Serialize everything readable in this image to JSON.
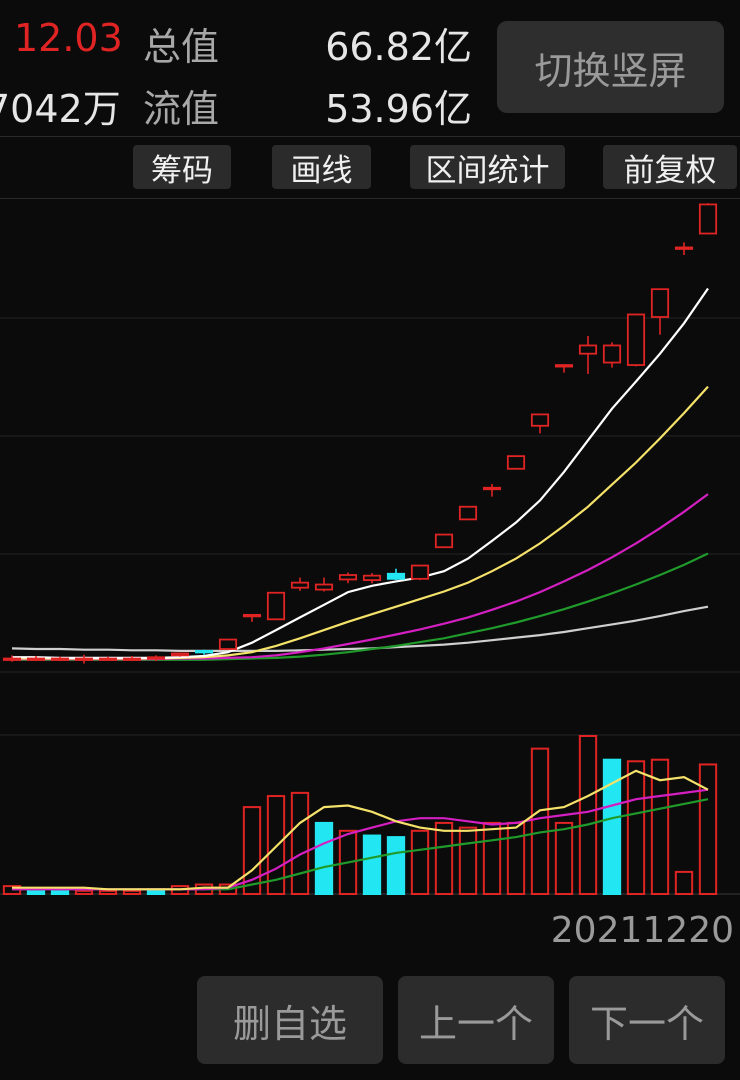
{
  "header": {
    "price": "12.03",
    "volume": "7042万",
    "total_value_label": "总值",
    "total_value": "66.82亿",
    "float_value_label": "流值",
    "float_value": "53.96亿",
    "switch_button": "切换竖屏"
  },
  "toolbar": {
    "chips": "筹码",
    "draw_line": "画线",
    "range_stats": "区间统计",
    "adjust": "前复权"
  },
  "chart": {
    "date_label": "20211220"
  },
  "bottom": {
    "delete_watch": "删自选",
    "previous": "上一个",
    "next": "下一个"
  },
  "colors": {
    "up": "#e02424",
    "down": "#22e6f2",
    "ma5": "#ffffff",
    "ma10": "#f5e26a",
    "ma20": "#d41fc2",
    "ma30": "#1f9a2b",
    "ma60": "#cfcfcf"
  },
  "chart_data": {
    "type": "candlestick",
    "candles": [
      {
        "o": 1.0,
        "h": 1.05,
        "l": 0.95,
        "c": 1.0,
        "dir": "flat"
      },
      {
        "o": 1.0,
        "h": 1.04,
        "l": 0.96,
        "c": 1.0,
        "dir": "flat"
      },
      {
        "o": 1.0,
        "h": 1.03,
        "l": 0.96,
        "c": 1.0,
        "dir": "flat"
      },
      {
        "o": 1.0,
        "h": 1.06,
        "l": 0.92,
        "c": 1.0,
        "dir": "flat"
      },
      {
        "o": 1.0,
        "h": 1.03,
        "l": 0.96,
        "c": 1.0,
        "dir": "flat"
      },
      {
        "o": 1.0,
        "h": 1.04,
        "l": 0.96,
        "c": 1.0,
        "dir": "flat"
      },
      {
        "o": 1.0,
        "h": 1.05,
        "l": 0.96,
        "c": 1.02,
        "dir": "flat"
      },
      {
        "o": 1.05,
        "h": 1.08,
        "l": 1.03,
        "c": 1.08,
        "dir": "up"
      },
      {
        "o": 1.12,
        "h": 1.14,
        "l": 1.06,
        "c": 1.1,
        "dir": "down"
      },
      {
        "o": 1.15,
        "h": 1.3,
        "l": 1.15,
        "c": 1.3,
        "dir": "up"
      },
      {
        "o": 1.68,
        "h": 1.7,
        "l": 1.58,
        "c": 1.69,
        "dir": "up"
      },
      {
        "o": 1.62,
        "h": 2.04,
        "l": 1.62,
        "c": 2.04,
        "dir": "up"
      },
      {
        "o": 2.12,
        "h": 2.28,
        "l": 2.07,
        "c": 2.2,
        "dir": "up"
      },
      {
        "o": 2.09,
        "h": 2.28,
        "l": 2.06,
        "c": 2.17,
        "dir": "up"
      },
      {
        "o": 2.25,
        "h": 2.36,
        "l": 2.19,
        "c": 2.32,
        "dir": "up"
      },
      {
        "o": 2.24,
        "h": 2.35,
        "l": 2.19,
        "c": 2.31,
        "dir": "up"
      },
      {
        "o": 2.34,
        "h": 2.42,
        "l": 2.24,
        "c": 2.26,
        "dir": "down"
      },
      {
        "o": 2.26,
        "h": 2.47,
        "l": 2.24,
        "c": 2.47,
        "dir": "up"
      },
      {
        "o": 2.76,
        "h": 2.96,
        "l": 2.76,
        "c": 2.96,
        "dir": "up"
      },
      {
        "o": 3.2,
        "h": 3.4,
        "l": 3.2,
        "c": 3.4,
        "dir": "up"
      },
      {
        "o": 3.68,
        "h": 3.76,
        "l": 3.56,
        "c": 3.7,
        "dir": "up"
      },
      {
        "o": 4.0,
        "h": 4.2,
        "l": 4.0,
        "c": 4.2,
        "dir": "up"
      },
      {
        "o": 4.68,
        "h": 4.86,
        "l": 4.56,
        "c": 4.86,
        "dir": "up"
      },
      {
        "o": 5.63,
        "h": 5.65,
        "l": 5.52,
        "c": 5.64,
        "dir": "up"
      },
      {
        "o": 5.82,
        "h": 6.1,
        "l": 5.5,
        "c": 5.95,
        "dir": "up"
      },
      {
        "o": 5.68,
        "h": 6.0,
        "l": 5.6,
        "c": 5.95,
        "dir": "up"
      },
      {
        "o": 5.64,
        "h": 6.44,
        "l": 5.62,
        "c": 6.44,
        "dir": "up"
      },
      {
        "o": 6.4,
        "h": 6.84,
        "l": 6.12,
        "c": 6.84,
        "dir": "up"
      },
      {
        "o": 7.5,
        "h": 7.58,
        "l": 7.38,
        "c": 7.5,
        "dir": "up"
      },
      {
        "o": 7.72,
        "h": 8.2,
        "l": 7.72,
        "c": 8.18,
        "dir": "up"
      }
    ],
    "ma5": [
      1.02,
      1.02,
      1.01,
      1.01,
      1.01,
      1.01,
      1.01,
      1.02,
      1.04,
      1.1,
      1.25,
      1.45,
      1.65,
      1.85,
      2.05,
      2.15,
      2.22,
      2.28,
      2.38,
      2.58,
      2.86,
      3.15,
      3.5,
      3.95,
      4.45,
      4.95,
      5.38,
      5.82,
      6.3,
      6.85
    ],
    "ma10": [
      1.0,
      1.0,
      1.0,
      1.0,
      1.0,
      1.0,
      1.0,
      1.01,
      1.02,
      1.05,
      1.1,
      1.2,
      1.32,
      1.45,
      1.58,
      1.7,
      1.82,
      1.94,
      2.06,
      2.2,
      2.38,
      2.58,
      2.82,
      3.1,
      3.4,
      3.75,
      4.1,
      4.48,
      4.88,
      5.3
    ],
    "ma20": [
      0.99,
      0.99,
      0.99,
      0.99,
      0.99,
      0.99,
      0.99,
      1.0,
      1.0,
      1.01,
      1.02,
      1.05,
      1.1,
      1.16,
      1.23,
      1.3,
      1.38,
      1.46,
      1.55,
      1.65,
      1.77,
      1.9,
      2.05,
      2.22,
      2.4,
      2.6,
      2.82,
      3.06,
      3.32,
      3.6
    ],
    "ma30": [
      0.98,
      0.98,
      0.98,
      0.98,
      0.98,
      0.98,
      0.98,
      0.98,
      0.98,
      0.99,
      1.0,
      1.01,
      1.03,
      1.06,
      1.1,
      1.15,
      1.2,
      1.26,
      1.32,
      1.4,
      1.48,
      1.57,
      1.67,
      1.78,
      1.9,
      2.03,
      2.17,
      2.32,
      2.48,
      2.66
    ],
    "ma60": [
      1.16,
      1.15,
      1.15,
      1.14,
      1.14,
      1.13,
      1.13,
      1.12,
      1.12,
      1.12,
      1.12,
      1.12,
      1.13,
      1.14,
      1.15,
      1.16,
      1.18,
      1.2,
      1.22,
      1.25,
      1.29,
      1.33,
      1.37,
      1.42,
      1.48,
      1.54,
      1.6,
      1.67,
      1.75,
      1.82
    ],
    "volume": [
      0.05,
      0.03,
      0.03,
      0.02,
      0.02,
      0.02,
      0.03,
      0.05,
      0.06,
      0.06,
      0.55,
      0.62,
      0.64,
      0.45,
      0.4,
      0.37,
      0.36,
      0.4,
      0.45,
      0.42,
      0.45,
      0.45,
      0.92,
      0.45,
      1.0,
      0.85,
      0.84,
      0.85,
      0.14,
      0.82
    ],
    "volume_dir": [
      "up",
      "down",
      "down",
      "up",
      "up",
      "up",
      "down",
      "up",
      "up",
      "up",
      "up",
      "up",
      "up",
      "down",
      "up",
      "down",
      "down",
      "up",
      "up",
      "up",
      "up",
      "up",
      "up",
      "up",
      "up",
      "down",
      "up",
      "up",
      "up",
      "up"
    ],
    "vol_ma5": [
      0.04,
      0.04,
      0.04,
      0.04,
      0.03,
      0.03,
      0.03,
      0.03,
      0.04,
      0.04,
      0.15,
      0.3,
      0.45,
      0.55,
      0.56,
      0.52,
      0.46,
      0.42,
      0.4,
      0.4,
      0.41,
      0.42,
      0.53,
      0.55,
      0.62,
      0.7,
      0.78,
      0.72,
      0.74,
      0.66
    ],
    "vol_ma10": [
      0.03,
      0.03,
      0.03,
      0.03,
      0.03,
      0.03,
      0.03,
      0.03,
      0.03,
      0.04,
      0.09,
      0.16,
      0.25,
      0.32,
      0.38,
      0.42,
      0.46,
      0.48,
      0.48,
      0.46,
      0.44,
      0.45,
      0.48,
      0.5,
      0.52,
      0.56,
      0.6,
      0.62,
      0.64,
      0.66
    ],
    "vol_ma20": [
      0.03,
      0.03,
      0.03,
      0.03,
      0.03,
      0.03,
      0.03,
      0.03,
      0.03,
      0.03,
      0.06,
      0.09,
      0.13,
      0.17,
      0.2,
      0.23,
      0.26,
      0.28,
      0.3,
      0.32,
      0.34,
      0.36,
      0.39,
      0.41,
      0.44,
      0.48,
      0.51,
      0.54,
      0.57,
      0.6
    ]
  }
}
